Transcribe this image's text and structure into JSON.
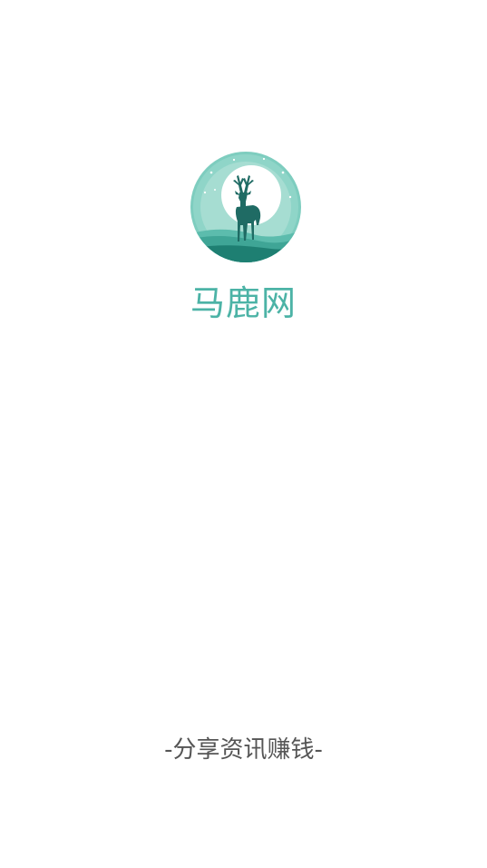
{
  "app": {
    "name": "马鹿网",
    "slogan": "-分享资讯赚钱-",
    "logo_icon": "deer-moon-logo-icon"
  },
  "colors": {
    "brand": "#4cb3a6",
    "logo_light": "#7ecdbf",
    "logo_mid": "#3fa596",
    "logo_dark": "#1e7f72",
    "deer": "#1f6b64",
    "slogan": "#555555",
    "background": "#ffffff"
  }
}
